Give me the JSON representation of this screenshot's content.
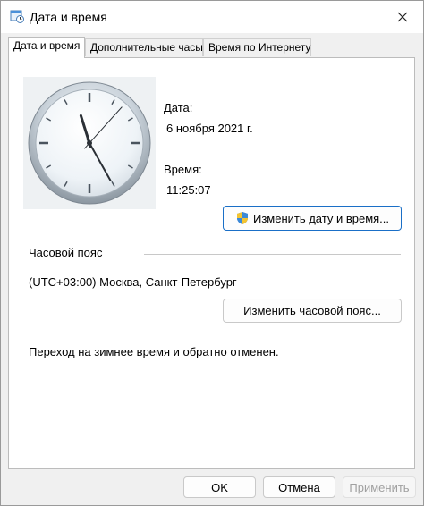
{
  "window": {
    "title": "Дата и время",
    "icons": {
      "app": "calendar-clock-icon",
      "close": "close-icon"
    }
  },
  "tabs": [
    {
      "label": "Дата и время",
      "active": true
    },
    {
      "label": "Дополнительные часы",
      "active": false
    },
    {
      "label": "Время по Интернету",
      "active": false
    }
  ],
  "datetime": {
    "date_label": "Дата:",
    "date_value": "6 ноября 2021 г.",
    "time_label": "Время:",
    "time_value": "11:25:07",
    "change_button": "Изменить дату и время...",
    "change_button_icon": "uac-shield-icon"
  },
  "clock": {
    "hours": 11,
    "minutes": 25,
    "seconds": 7
  },
  "timezone": {
    "section_label": "Часовой пояс",
    "value": "(UTC+03:00) Москва, Санкт-Петербург",
    "change_button": "Изменить часовой пояс..."
  },
  "dst_note": "Переход на зимнее время и обратно отменен.",
  "footer": {
    "ok": "OK",
    "cancel": "Отмена",
    "apply": "Применить"
  },
  "colors": {
    "accent_border": "#1a6fc7",
    "disabled_text": "#a0a0a0"
  }
}
